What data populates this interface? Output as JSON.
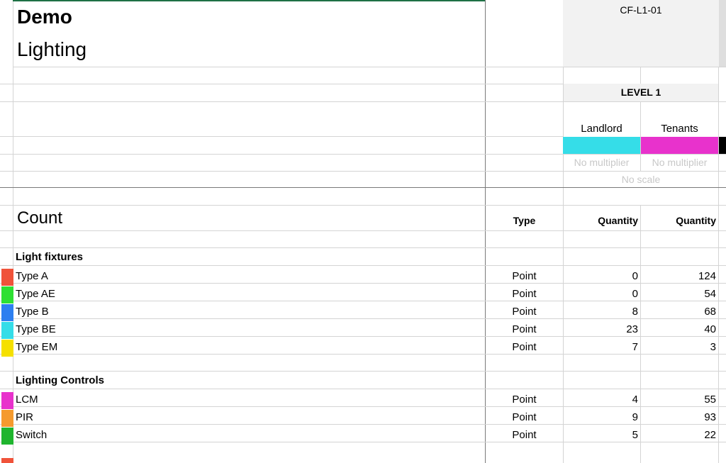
{
  "header": {
    "title": "Demo",
    "subtitle": "Lighting",
    "sheet_code": "CF-L1-01",
    "level": "LEVEL 1",
    "columns": [
      "Landlord",
      "Tenants"
    ],
    "multipliers": [
      "No multiplier",
      "No multiplier"
    ],
    "scale": "No scale",
    "column_colors": [
      "#35dde8",
      "#e832cc"
    ]
  },
  "table": {
    "section_title": "Count",
    "type_header": "Type",
    "quantity_headers": [
      "Quantity",
      "Quantity"
    ],
    "groups": [
      {
        "name": "Light fixtures",
        "rows": [
          {
            "label": "Type A",
            "type": "Point",
            "landlord": "0",
            "tenants": "124",
            "color": "#f0533a"
          },
          {
            "label": "Type AE",
            "type": "Point",
            "landlord": "0",
            "tenants": "54",
            "color": "#2ee033"
          },
          {
            "label": "Type B",
            "type": "Point",
            "landlord": "8",
            "tenants": "68",
            "color": "#2d7ff0"
          },
          {
            "label": "Type BE",
            "type": "Point",
            "landlord": "23",
            "tenants": "40",
            "color": "#35dde8"
          },
          {
            "label": "Type EM",
            "type": "Point",
            "landlord": "7",
            "tenants": "3",
            "color": "#f5e000"
          }
        ]
      },
      {
        "name": "Lighting Controls",
        "rows": [
          {
            "label": "LCM",
            "type": "Point",
            "landlord": "4",
            "tenants": "55",
            "color": "#e832cc"
          },
          {
            "label": "PIR",
            "type": "Point",
            "landlord": "9",
            "tenants": "93",
            "color": "#f59a2e"
          },
          {
            "label": "Switch",
            "type": "Point",
            "landlord": "5",
            "tenants": "22",
            "color": "#1fb52e"
          }
        ]
      }
    ]
  }
}
